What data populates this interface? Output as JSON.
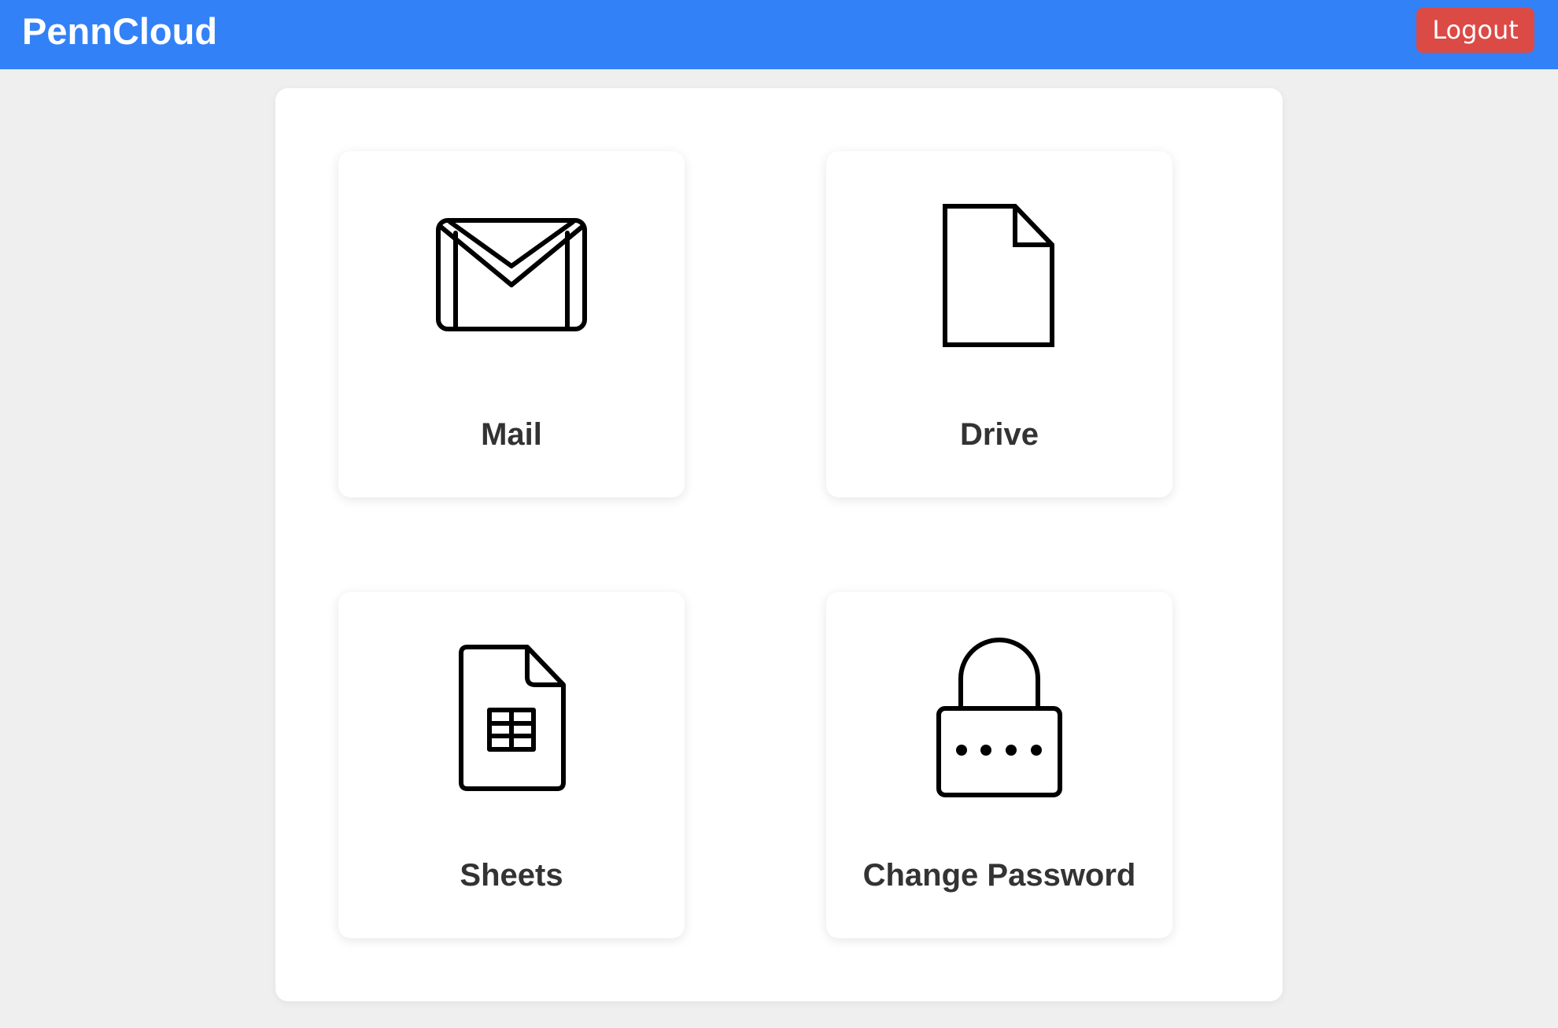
{
  "header": {
    "brand": "PennCloud",
    "logout_label": "Logout",
    "background_color": "#3381f7",
    "logout_color": "#dc4a46"
  },
  "tiles": [
    {
      "label": "Mail",
      "icon": "mail-icon"
    },
    {
      "label": "Drive",
      "icon": "document-icon"
    },
    {
      "label": "Sheets",
      "icon": "spreadsheet-icon"
    },
    {
      "label": "Change Password",
      "icon": "lock-icon"
    }
  ]
}
